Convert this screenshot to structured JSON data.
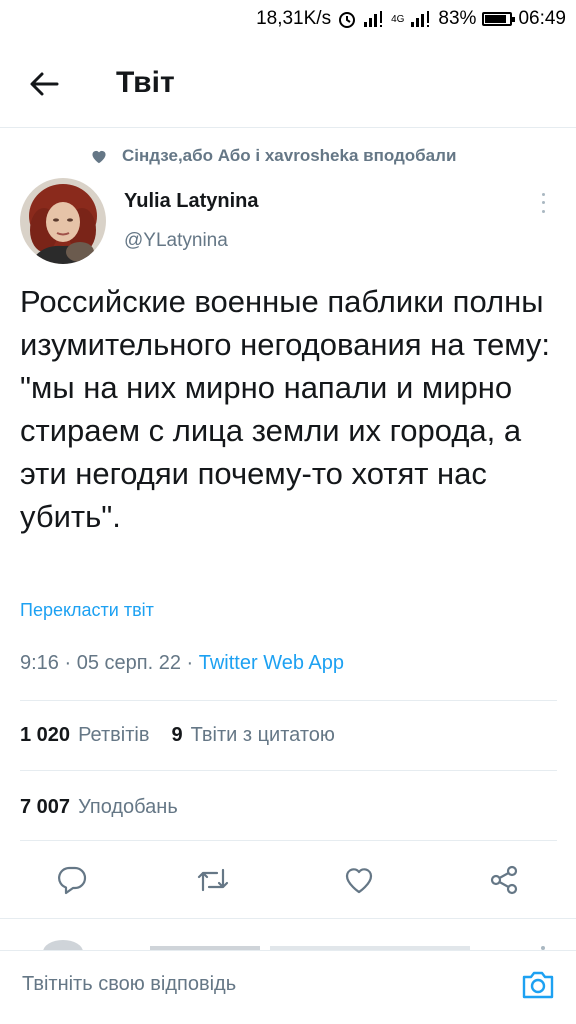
{
  "status_bar": {
    "speed": "18,31K/s",
    "battery": "83%",
    "network": "4G",
    "time": "06:49"
  },
  "header": {
    "back_icon": "arrow-left-icon",
    "title": "Твіт"
  },
  "social_context": {
    "icon": "heart-filled-icon",
    "text": "Сіндзе,або Або і xavrosheka вподобали"
  },
  "author": {
    "name": "Yulia Latynina",
    "handle": "@YLatynina"
  },
  "tweet": {
    "text": "Российские военные паблики полны изумительного негодования на тему: \"мы на них мирно напали и мирно стираем с лица земли их города, а эти негодяи почему-то хотят нас убить\".",
    "translate_label": "Перекласти твіт",
    "time": "9:16",
    "date": "05 серп. 22",
    "source": "Twitter Web App",
    "separator": " · "
  },
  "stats": {
    "retweets_count": "1 020",
    "retweets_label": "Ретвітів",
    "quotes_count": "9",
    "quotes_label": "Твіти з цитатою",
    "likes_count": "7 007",
    "likes_label": "Уподобань"
  },
  "actions": {
    "reply_icon": "reply-icon",
    "retweet_icon": "retweet-icon",
    "like_icon": "heart-outline-icon",
    "share_icon": "share-icon"
  },
  "compose": {
    "placeholder": "Твітніть свою відповідь",
    "camera_icon": "camera-icon"
  },
  "colors": {
    "accent": "#1da1f2",
    "secondary_text": "#657786",
    "divider": "#e6ecf0"
  }
}
